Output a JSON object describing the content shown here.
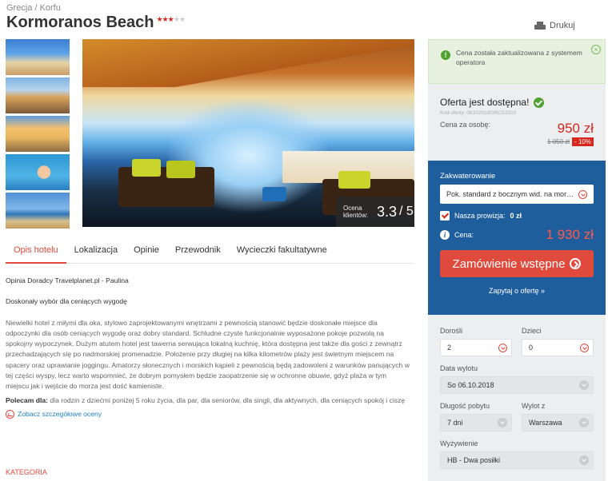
{
  "breadcrumb": "Grecja / Korfu",
  "hotel": {
    "name": "Kormoranos Beach",
    "stars_filled": "★★★",
    "stars_empty": "★★"
  },
  "print_label": "Drukuj",
  "gallery": {
    "rating_label": "Ocena klientów:",
    "rating_value": "3.3",
    "rating_max": "/ 5"
  },
  "tabs": [
    {
      "label": "Opis hotelu",
      "active": true
    },
    {
      "label": "Lokalizacja"
    },
    {
      "label": "Opinie"
    },
    {
      "label": "Przewodnik"
    },
    {
      "label": "Wycieczki fakultatywne"
    }
  ],
  "description": {
    "lead": "Opinia Doradcy Travelplanet.pl - Paulina",
    "subhead": "Doskonały wybór dla ceniących wygodę",
    "body": "Niewielki hotel z miłymi dla oka, stylowo zaprojektowanymi wnętrzami z pewnością stanowić będzie doskonałe miejsce dla odpoczynki dla osób ceniących wygodę oraz dobry standard. Schludne czyste funkcjonalnie wyposażone pokoje pozwolą na spokojny wypoczynek. Dużym atutem hotel jest tawerna serwująca lokalną kuchnię, która dostępna jest także dla gości z zewnątrz przechadzających się po nadmorskiej promenadzie. Położenie przy długiej na kilka kilometrów plaży jest świetnym miejscem na spacery oraz uprawianie joggingu. Amatorzy słonecznych i morskich kąpieli z pewnością będą zadowoleni z warunków panujących w tej części wyspy, lecz warto wspomnieć, że dobrym pomysłem będzie zaopatrzenie się w ochronne obuwie, gdyż plaża w tym miejscu jak i wejście do morza jest dość kamieniste.",
    "recommend_label": "Polecam dla:",
    "recommend_text": " dla rodzin z dziećmi poniżej 5 roku życia, dla par, dla seniorów, dla singli, dla aktywnych, dla ceniących spokój i ciszę",
    "ratings_link": "Zobacz szczegółowe oceny",
    "category_heading": "KATEGORIA"
  },
  "notice": {
    "icon": "!",
    "text": "Cena została zaktualizowana z systemem operatora",
    "close": "×"
  },
  "offer": {
    "status": "Oferta jest dostępna!",
    "code": "Kod oferty: 06102018GRCS2310",
    "price_label": "Cena za osobę:",
    "price": "950 zł",
    "old_price": "1 050 zł",
    "discount": "- 10%"
  },
  "booking": {
    "accommodation_label": "Zakwaterowanie",
    "accommodation_value": "Pok. standard z bocznym wid. na mor…",
    "commission_label": "Nasza prowizja:",
    "commission_value": "0 zł",
    "total_label": "Cena:",
    "total_price": "1 930 zł",
    "order_button": "Zamówienie wstępne",
    "ask_link": "Zapytaj o ofertę »"
  },
  "form": {
    "adults_label": "Dorośli",
    "adults_value": "2",
    "children_label": "Dzieci",
    "children_value": "0",
    "departure_label": "Data wylotu",
    "departure_value": "So 06.10.2018",
    "duration_label": "Długość pobytu",
    "duration_value": "7 dni",
    "from_label": "Wylot z",
    "from_value": "Warszawa",
    "board_label": "Wyżywienie",
    "board_value": "HB - Dwa posiłki"
  },
  "colors": {
    "accent_red": "#e04a3c",
    "booking_blue": "#1f5e9c",
    "success_green": "#4ea32e"
  }
}
